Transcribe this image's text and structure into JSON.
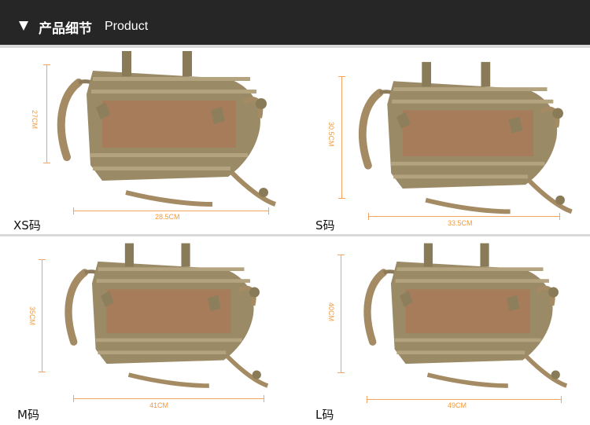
{
  "header": {
    "title_cn": "产品细节",
    "title_en": "Product"
  },
  "products": [
    {
      "size_label": "XS码",
      "height": "27CM",
      "width": "28.5CM"
    },
    {
      "size_label": "S码",
      "height": "30.5CM",
      "width": "33.5CM"
    },
    {
      "size_label": "M码",
      "height": "35CM",
      "width": "41CM"
    },
    {
      "size_label": "L码",
      "height": "40CM",
      "width": "49CM"
    }
  ],
  "colors": {
    "header_bg": "#262626",
    "measure": "#f4a460",
    "vest": "#9a8a66",
    "panel": "#a77c5b"
  }
}
